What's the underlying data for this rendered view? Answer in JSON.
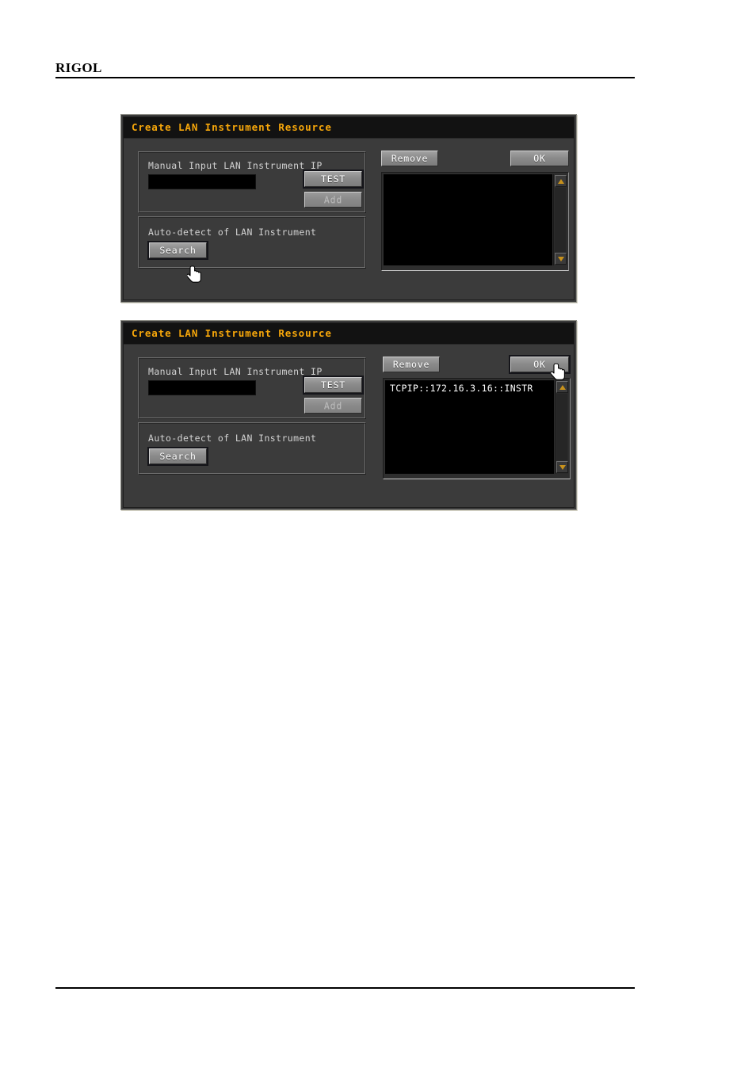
{
  "page": {
    "brand": "RIGOL"
  },
  "dialogs": [
    {
      "title": "Create LAN Instrument Resource",
      "manual_group": {
        "label": "Manual Input LAN Instrument IP",
        "input_value": "",
        "input_placeholder": "",
        "test_button": "TEST",
        "add_button": "Add",
        "add_disabled": true
      },
      "auto_group": {
        "label": "Auto-detect of LAN Instrument",
        "search_button": "Search"
      },
      "right_panel": {
        "remove_button": "Remove",
        "ok_button": "OK",
        "list_items": [],
        "scroll_up_icon": "triangle-up-icon",
        "scroll_down_icon": "triangle-down-icon"
      },
      "cursor": {
        "icon": "hand-pointer-cursor",
        "target": "search-button"
      }
    },
    {
      "title": "Create LAN Instrument Resource",
      "manual_group": {
        "label": "Manual Input LAN Instrument IP",
        "input_value": "",
        "input_placeholder": "",
        "test_button": "TEST",
        "add_button": "Add",
        "add_disabled": true
      },
      "auto_group": {
        "label": "Auto-detect of LAN Instrument",
        "search_button": "Search"
      },
      "right_panel": {
        "remove_button": "Remove",
        "ok_button": "OK",
        "list_items": [
          "TCPIP::172.16.3.16::INSTR"
        ],
        "scroll_up_icon": "triangle-up-icon",
        "scroll_down_icon": "triangle-down-icon"
      },
      "cursor": {
        "icon": "hand-pointer-cursor",
        "target": "ok-button"
      }
    }
  ],
  "colors": {
    "title_text": "#f7a70a",
    "dialog_bg": "#3b3b3b",
    "titlebar_bg": "#121212",
    "listbox_bg": "#000000",
    "scroll_arrow": "#c8921c"
  }
}
